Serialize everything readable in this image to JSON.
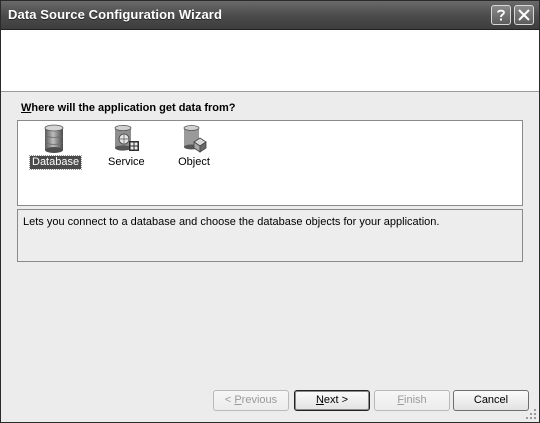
{
  "window": {
    "title": "Data Source Configuration Wizard",
    "help_label": "?",
    "close_label": "X"
  },
  "prompt": {
    "mnemonic": "W",
    "rest": "here will the application get data from?"
  },
  "datasource_types": [
    {
      "label": "Database",
      "icon": "database-icon",
      "selected": true
    },
    {
      "label": "Service",
      "icon": "service-icon",
      "selected": false
    },
    {
      "label": "Object",
      "icon": "object-icon",
      "selected": false
    }
  ],
  "description": "Lets you connect to a database and choose the database objects for your application.",
  "buttons": {
    "previous": {
      "mnemonic": "P",
      "prefix": "< ",
      "rest": "revious",
      "enabled": false
    },
    "next": {
      "mnemonic": "N",
      "prefix": "",
      "rest": "ext >",
      "enabled": true,
      "default": true
    },
    "finish": {
      "mnemonic": "F",
      "prefix": "",
      "rest": "inish",
      "enabled": false
    },
    "cancel": {
      "label": "Cancel",
      "enabled": true
    }
  }
}
